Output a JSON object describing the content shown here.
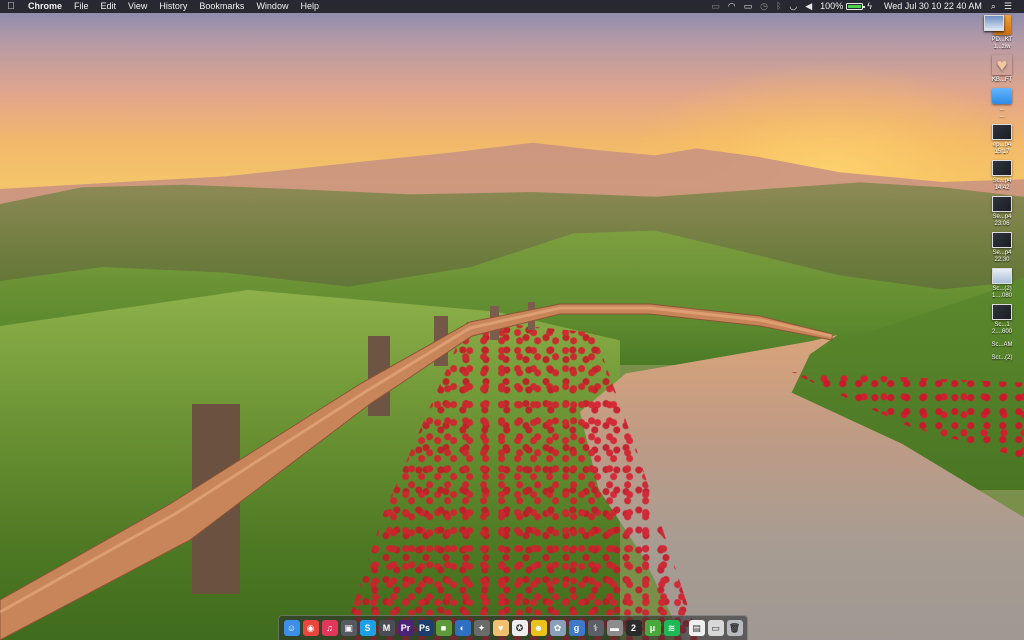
{
  "menubar": {
    "apple_icon": "apple-logo-icon",
    "app_name": "Chrome",
    "menus": [
      "File",
      "Edit",
      "View",
      "History",
      "Bookmarks",
      "Window",
      "Help"
    ],
    "status": {
      "battery_percent": "100%",
      "battery_level": 1.0,
      "clock": "Wed Jul 30  10 22 40 AM"
    }
  },
  "desktop": {
    "icons": [
      {
        "label": "PD...KT",
        "sub": "1...ziw",
        "kind": "book"
      },
      {
        "label": "KB...FT",
        "sub": "",
        "kind": "heart"
      },
      {
        "label": "...",
        "sub": "...",
        "kind": "folder"
      },
      {
        "label": "ep...p4",
        "sub": "15:17",
        "kind": "dark"
      },
      {
        "label": "Sc...p4",
        "sub": "14:42",
        "kind": "dark"
      },
      {
        "label": "Se...p4",
        "sub": "23:06",
        "kind": "dark"
      },
      {
        "label": "Se...p4",
        "sub": "22:30",
        "kind": "dark"
      },
      {
        "label": "Sc...(2)",
        "sub": "1....080",
        "kind": "light"
      },
      {
        "label": "Sc...1",
        "sub": "2....600",
        "kind": "dark"
      },
      {
        "label": "Sc...AM",
        "sub": "",
        "kind": "sky"
      },
      {
        "label": "Scr...(2)",
        "sub": "",
        "kind": "sky"
      }
    ]
  },
  "dock": {
    "apps": [
      {
        "name": "finder",
        "glyph": "☺",
        "bg": "#3c8ee8"
      },
      {
        "name": "chrome",
        "glyph": "◉",
        "bg": "#e8453c"
      },
      {
        "name": "itunes",
        "glyph": "♫",
        "bg": "#e0375a"
      },
      {
        "name": "screenshot",
        "glyph": "▣",
        "bg": "#555a62"
      },
      {
        "name": "skype",
        "glyph": "S",
        "bg": "#1da1e6"
      },
      {
        "name": "mail-m",
        "glyph": "M",
        "bg": "#4a4d55"
      },
      {
        "name": "premiere",
        "glyph": "Pr",
        "bg": "#4b2478"
      },
      {
        "name": "photoshop",
        "glyph": "Ps",
        "bg": "#1c3e6e"
      },
      {
        "name": "minecraft",
        "glyph": "■",
        "bg": "#5f9a3a"
      },
      {
        "name": "browser",
        "glyph": "◐",
        "bg": "#2f6fbf"
      },
      {
        "name": "extra",
        "glyph": "✦",
        "bg": "#6b6b6b"
      },
      {
        "name": "heart-app",
        "glyph": "♥",
        "bg": "#f0c070"
      },
      {
        "name": "instruments",
        "glyph": "✪",
        "bg": "#ededed"
      },
      {
        "name": "smiley",
        "glyph": "☻",
        "bg": "#e8c31c"
      },
      {
        "name": "preview",
        "glyph": "✿",
        "bg": "#8aa0b8"
      },
      {
        "name": "gimp",
        "glyph": "g",
        "bg": "#3f78c8"
      },
      {
        "name": "tool",
        "glyph": "⚕",
        "bg": "#5c6066"
      },
      {
        "name": "drive",
        "glyph": "▬",
        "bg": "#8c8c8c"
      },
      {
        "name": "two",
        "glyph": "2",
        "bg": "#2b2b2b"
      },
      {
        "name": "utorrent",
        "glyph": "μ",
        "bg": "#4aa93b"
      },
      {
        "name": "spotify",
        "glyph": "≋",
        "bg": "#1db954"
      },
      {
        "name": "document",
        "glyph": "▤",
        "bg": "#efefef"
      },
      {
        "name": "window",
        "glyph": "▭",
        "bg": "#d8d8d8"
      },
      {
        "name": "trash",
        "glyph": "🗑",
        "bg": "#b8bcc2"
      }
    ]
  }
}
